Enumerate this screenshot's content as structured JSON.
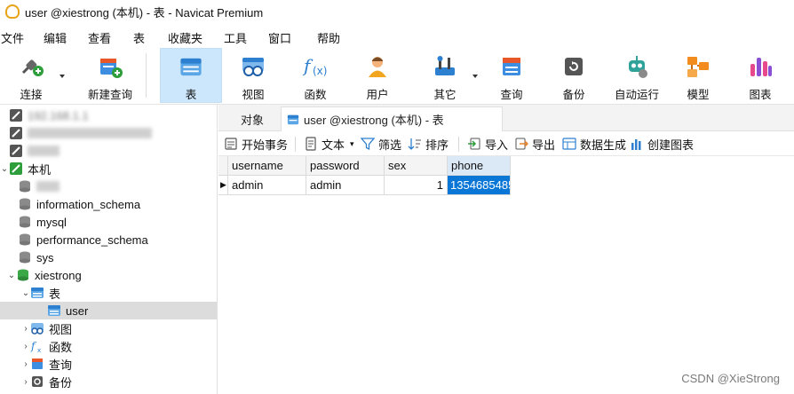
{
  "window": {
    "title": "user @xiestrong (本机) - 表 - Navicat Premium"
  },
  "menu": [
    "文件",
    "编辑",
    "查看",
    "表",
    "收藏夹",
    "工具",
    "窗口",
    "帮助"
  ],
  "toolbar": {
    "connect": "连接",
    "new_query": "新建查询",
    "table": "表",
    "view": "视图",
    "function": "函数",
    "user": "用户",
    "other": "其它",
    "query": "查询",
    "backup": "备份",
    "automation": "自动运行",
    "model": "模型",
    "chart": "图表"
  },
  "sidebar": {
    "conn1": "192.168.1.1",
    "local": "本机",
    "databases": [
      "information_schema",
      "mysql",
      "performance_schema",
      "sys"
    ],
    "xiestrong": "xiestrong",
    "tables_label": "表",
    "user_table": "user",
    "views_label": "视图",
    "functions_label": "函数",
    "queries_label": "查询",
    "backups_label": "备份"
  },
  "tabs": {
    "objects": "对象",
    "active": "user @xiestrong (本机) - 表"
  },
  "subtoolbar": {
    "begin_transaction": "开始事务",
    "text": "文本",
    "filter": "筛选",
    "sort": "排序",
    "import": "导入",
    "export": "导出",
    "data_gen": "数据生成",
    "create_chart": "创建图表"
  },
  "table": {
    "columns": [
      "username",
      "password",
      "sex",
      "phone"
    ],
    "rows": [
      {
        "username": "admin",
        "password": "admin",
        "sex": "1",
        "phone": "1354685485"
      }
    ]
  },
  "watermark": "CSDN @XieStrong",
  "colors": {
    "active_toolbar_bg": "#cce6fb",
    "selection": "#0a76d6",
    "tree_selected": "#dcdcdc"
  }
}
